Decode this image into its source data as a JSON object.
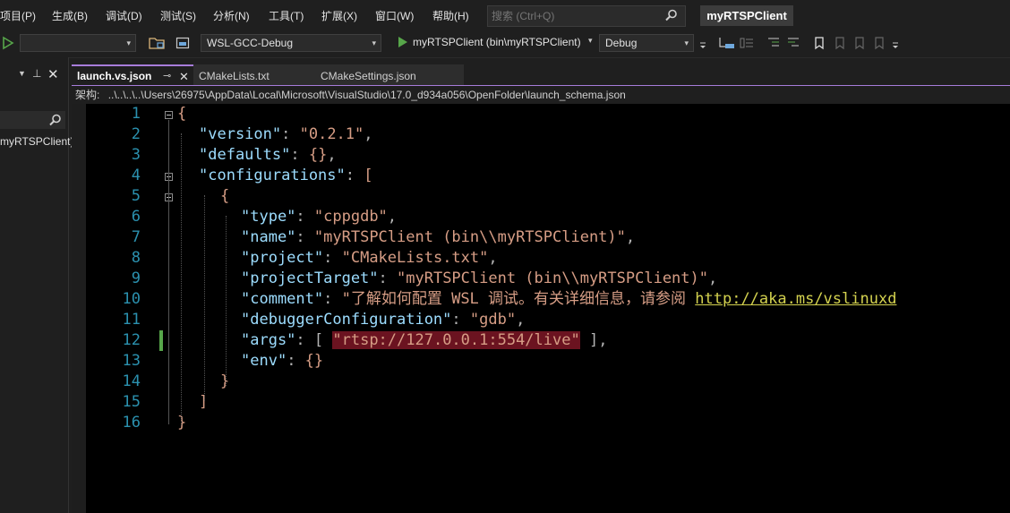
{
  "menu": {
    "items": [
      "项目(P)",
      "生成(B)",
      "调试(D)",
      "测试(S)",
      "分析(N)",
      "工具(T)",
      "扩展(X)",
      "窗口(W)",
      "帮助(H)"
    ]
  },
  "search": {
    "placeholder": "搜索 (Ctrl+Q)"
  },
  "solution_title": "myRTSPClient",
  "toolbar": {
    "config_combo": "WSL-GCC-Debug",
    "start_target": "myRTSPClient (bin\\myRTSPClient)",
    "build_mode": "Debug"
  },
  "left_panel": {
    "item": "myRTSPClient)"
  },
  "tabs": [
    {
      "label": "launch.vs.json",
      "active": true
    },
    {
      "label": "CMakeLists.txt",
      "active": false
    },
    {
      "label": "CMakeSettings.json",
      "active": false
    }
  ],
  "schema_path": {
    "label": "架构:",
    "value": "..\\..\\..\\..\\Users\\26975\\AppData\\Local\\Microsoft\\VisualStudio\\17.0_d934a056\\OpenFolder\\launch_schema.json"
  },
  "code": {
    "line_numbers": [
      "1",
      "2",
      "3",
      "4",
      "5",
      "6",
      "7",
      "8",
      "9",
      "10",
      "11",
      "12",
      "13",
      "14",
      "15",
      "16"
    ],
    "lines": [
      [
        [
          "b",
          "{"
        ]
      ],
      [
        [
          "k",
          "\"version\""
        ],
        [
          "p",
          ": "
        ],
        [
          "s",
          "\"0.2.1\""
        ],
        [
          "p",
          ","
        ]
      ],
      [
        [
          "k",
          "\"defaults\""
        ],
        [
          "p",
          ": "
        ],
        [
          "b",
          "{}"
        ],
        [
          "p",
          ","
        ]
      ],
      [
        [
          "k",
          "\"configurations\""
        ],
        [
          "p",
          ": "
        ],
        [
          "b",
          "["
        ]
      ],
      [
        [
          "b",
          "{"
        ]
      ],
      [
        [
          "k",
          "\"type\""
        ],
        [
          "p",
          ": "
        ],
        [
          "s",
          "\"cppgdb\""
        ],
        [
          "p",
          ","
        ]
      ],
      [
        [
          "k",
          "\"name\""
        ],
        [
          "p",
          ": "
        ],
        [
          "s",
          "\"myRTSPClient (bin\\\\myRTSPClient)\""
        ],
        [
          "p",
          ","
        ]
      ],
      [
        [
          "k",
          "\"project\""
        ],
        [
          "p",
          ": "
        ],
        [
          "s",
          "\"CMakeLists.txt\""
        ],
        [
          "p",
          ","
        ]
      ],
      [
        [
          "k",
          "\"projectTarget\""
        ],
        [
          "p",
          ": "
        ],
        [
          "s",
          "\"myRTSPClient (bin\\\\myRTSPClient)\""
        ],
        [
          "p",
          ","
        ]
      ],
      [
        [
          "k",
          "\"comment\""
        ],
        [
          "p",
          ": "
        ],
        [
          "s",
          "\"了解如何配置 WSL 调试。有关详细信息，请参阅 "
        ],
        [
          "u",
          "http://aka.ms/vslinuxd"
        ]
      ],
      [
        [
          "k",
          "\"debuggerConfiguration\""
        ],
        [
          "p",
          ": "
        ],
        [
          "s",
          "\"gdb\""
        ],
        [
          "p",
          ","
        ]
      ],
      [
        [
          "k",
          "\"args\""
        ],
        [
          "p",
          ": [ "
        ],
        [
          "h",
          "\"rtsp://127.0.0.1:554/live\""
        ],
        [
          "p",
          " ],"
        ]
      ],
      [
        [
          "k",
          "\"env\""
        ],
        [
          "p",
          ": "
        ],
        [
          "b",
          "{}"
        ]
      ],
      [
        [
          "b",
          "}"
        ]
      ],
      [
        [
          "b",
          "]"
        ]
      ],
      [
        [
          "b",
          "}"
        ]
      ]
    ]
  },
  "colors": {
    "key": "#9cdcfe",
    "string": "#d69d85",
    "link": "#d4d24f",
    "highlight_bg": "#6b1320",
    "line_number": "#2b91af",
    "change_marker": "#57a64a"
  }
}
